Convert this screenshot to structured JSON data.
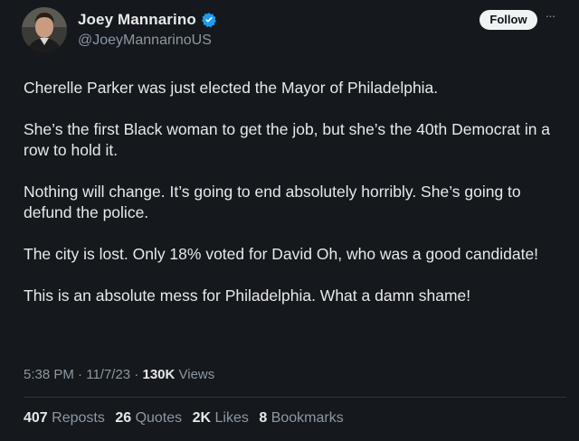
{
  "author": {
    "display_name": "Joey Mannarino",
    "handle": "@JoeyMannarinoUS",
    "verified": true
  },
  "actions": {
    "follow_label": "Follow",
    "more_label": "···"
  },
  "tweet": {
    "paragraphs": [
      "Cherelle Parker was just elected the Mayor of Philadelphia.",
      "She’s the first Black woman to get the job, but she’s the 40th Democrat in a row to hold it.",
      "Nothing will change. It’s going to end absolutely horribly. She’s going to defund the police.",
      "The city is lost. Only 18% voted for David Oh, who was a good candidate!",
      "This is an absolute mess for Philadelphia. What a damn shame!"
    ]
  },
  "meta": {
    "time": "5:38 PM",
    "sep1": " · ",
    "date": "11/7/23",
    "sep2": " · ",
    "views_count": "130K",
    "views_label": " Views"
  },
  "stats": {
    "reposts_count": "407",
    "reposts_label": "Reposts",
    "quotes_count": "26",
    "quotes_label": "Quotes",
    "likes_count": "2K",
    "likes_label": "Likes",
    "bookmarks_count": "8",
    "bookmarks_label": "Bookmarks"
  },
  "colors": {
    "background": "#15181c",
    "text": "#e7e9ea",
    "secondary": "#8b98a5",
    "verified": "#1d9bf0"
  }
}
